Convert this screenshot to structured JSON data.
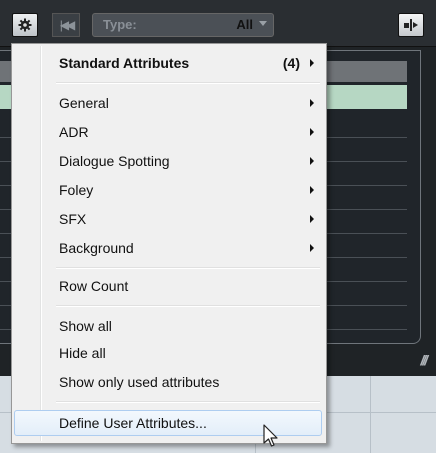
{
  "toolbar": {
    "type_label": "Type:",
    "type_value": "All",
    "gear_icon": "gear-icon",
    "skip_icon": "skip-back-icon",
    "export_icon": "export-icon"
  },
  "menu": {
    "header": {
      "label": "Standard Attributes",
      "count": "(4)"
    },
    "categories": [
      "General",
      "ADR",
      "Dialogue Spotting",
      "Foley",
      "SFX",
      "Background"
    ],
    "row_count": "Row Count",
    "show_all": "Show all",
    "hide_all": "Hide all",
    "show_used": "Show only used attributes",
    "define_user": "Define User Attributes..."
  },
  "colors": {
    "menu_bg": "#f0f0f0",
    "selected_row": "#b6d7c3",
    "hover_border": "#aecdf0"
  }
}
